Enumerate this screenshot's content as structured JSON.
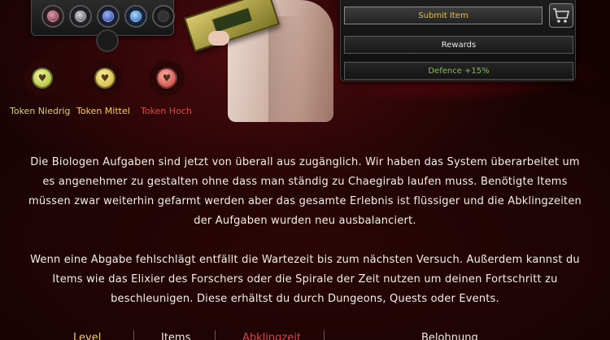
{
  "panel": {
    "submit_label": "Submit Item",
    "rewards_label": "Rewards",
    "defence_label": "Defence +15%"
  },
  "tokens": [
    {
      "label": "Token Niedrig",
      "color": "#d7d07a"
    },
    {
      "label": "Token Mittel",
      "color": "#f2cf4e"
    },
    {
      "label": "Token Hoch",
      "color": "#d84b44"
    }
  ],
  "description": {
    "paragraph_1": "Die Biologen Aufgaben sind jetzt von überall aus zugänglich. Wir haben das System überarbeitet um es angenehmer zu gestalten ohne dass man ständig zu Chaegirab laufen muss. Benötigte Items müssen zwar weiterhin gefarmt werden aber das gesamte Erlebnis ist flüssiger und die Abklingzeiten der Aufgaben wurden neu ausbalanciert.",
    "paragraph_2": "Wenn eine Abgabe fehlschlägt entfällt die Wartezeit bis zum nächsten Versuch. Außerdem kannst du Items wie das Elixier des Forschers oder die Spirale der Zeit nutzen um deinen Fortschritt zu beschleunigen. Diese erhältst du durch Dungeons, Quests oder Events."
  },
  "table": {
    "headers": [
      "Level",
      "Items",
      "Abklingzeit",
      "Belohnung"
    ]
  },
  "colors": {
    "background": "#180304",
    "accent_gold": "#e8c33a",
    "accent_green": "#7fc24b",
    "accent_red": "#d84b44"
  },
  "icons": [
    "cart-icon",
    "gem-slot-icons",
    "token-coin-icons"
  ]
}
